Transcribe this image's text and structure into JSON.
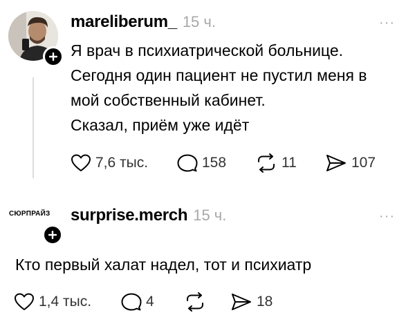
{
  "post": {
    "username": "mareliberum_",
    "time": "15 ч.",
    "more": "···",
    "text_lines": [
      "Я врач в психиатрической больнице.",
      "Сегодня один пациент не пустил меня в",
      "мой собственный кабинет.",
      "Сказал, приём уже идёт"
    ],
    "actions": {
      "likes": "7,6 тыс.",
      "replies": "158",
      "reposts": "11",
      "shares": "107"
    }
  },
  "reply": {
    "avatar_text": "СЮРПРАЙЗ",
    "username": "surprise.merch",
    "time": "15 ч.",
    "more": "···",
    "text": "Кто первый халат надел, тот и психиатр",
    "actions": {
      "likes": "1,4 тыс.",
      "replies": "4",
      "shares": "18"
    }
  },
  "icons": {
    "avatar_plus": "plus-icon",
    "like": "heart-icon",
    "reply": "comment-bubble-icon",
    "repost": "repost-icon",
    "share": "send-icon"
  },
  "colors": {
    "text": "#000000",
    "muted": "#a8a8a8",
    "action_text": "#333333",
    "thread_line": "#dcdcdc"
  }
}
